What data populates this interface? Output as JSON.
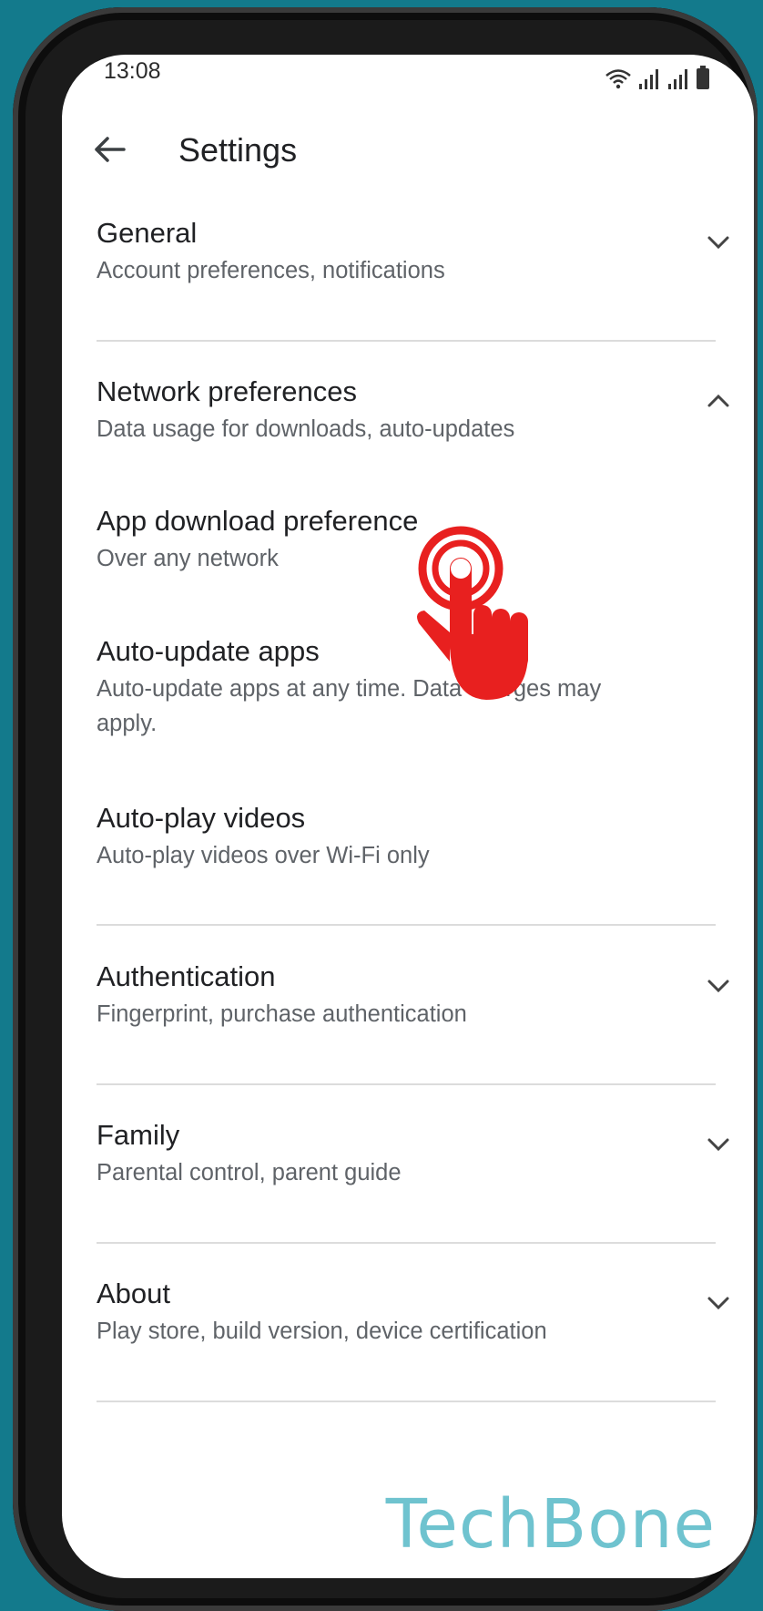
{
  "status_bar": {
    "time": "13:08"
  },
  "app_bar": {
    "title": "Settings"
  },
  "settings": [
    {
      "title": "General",
      "subtitle": "Account preferences, notifications",
      "chevron": "chevron-down-icon"
    },
    {
      "title": "Network preferences",
      "subtitle": "Data usage for downloads, auto-updates",
      "chevron": "chevron-up-icon"
    },
    {
      "title": "App download preference",
      "subtitle": "Over any network"
    },
    {
      "title": "Auto-update apps",
      "subtitle": "Auto-update apps at any time. Data charges may apply."
    },
    {
      "title": "Auto-play videos",
      "subtitle": "Auto-play videos over Wi-Fi only"
    },
    {
      "title": "Authentication",
      "subtitle": "Fingerprint, purchase authentication",
      "chevron": "chevron-down-icon"
    },
    {
      "title": "Family",
      "subtitle": "Parental control, parent guide",
      "chevron": "chevron-down-icon"
    },
    {
      "title": "About",
      "subtitle": "Play store, build version, device certification",
      "chevron": "chevron-down-icon"
    }
  ],
  "watermark": "TechBone",
  "colors": {
    "background": "#137a8c",
    "tap_indicator": "#e8201f",
    "watermark": "#6fc3cf"
  }
}
